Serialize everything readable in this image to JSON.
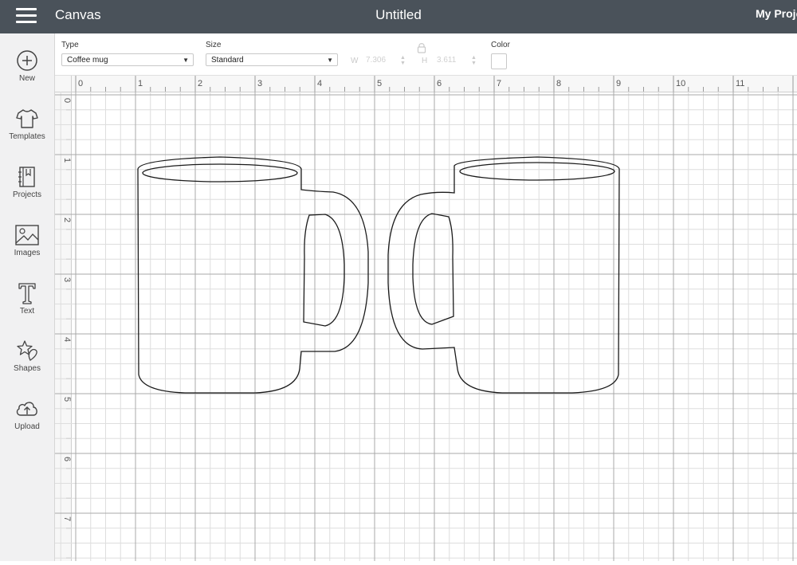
{
  "header": {
    "menu_icon": "hamburger-menu-icon",
    "app_title": "Canvas",
    "doc_title": "Untitled",
    "my_projects": "My Projects"
  },
  "sidebar": {
    "items": [
      {
        "label": "New",
        "icon": "plus-circle-icon"
      },
      {
        "label": "Templates",
        "icon": "tshirt-icon"
      },
      {
        "label": "Projects",
        "icon": "notebook-icon"
      },
      {
        "label": "Images",
        "icon": "image-icon"
      },
      {
        "label": "Text",
        "icon": "text-icon"
      },
      {
        "label": "Shapes",
        "icon": "shapes-icon"
      },
      {
        "label": "Upload",
        "icon": "cloud-upload-icon"
      }
    ]
  },
  "properties": {
    "type_label": "Type",
    "type_value": "Coffee mug",
    "size_label": "Size",
    "size_value": "Standard",
    "w_label": "W",
    "w_value": "7.306",
    "h_label": "H",
    "h_value": "3.611",
    "color_label": "Color",
    "lock_icon": "lock-icon",
    "swatch_color": "#ffffff"
  },
  "ruler": {
    "top_labels": [
      "0",
      "1",
      "2",
      "3",
      "4",
      "5",
      "6",
      "7",
      "8",
      "9",
      "10",
      "11"
    ],
    "left_labels": [
      "0",
      "1",
      "2",
      "3",
      "4",
      "5",
      "6",
      "7"
    ]
  },
  "colors": {
    "header_bg": "#4a525a",
    "sidebar_bg": "#f1f1f2",
    "grid_major": "#a9a9a9",
    "grid_minor": "#dedede"
  }
}
